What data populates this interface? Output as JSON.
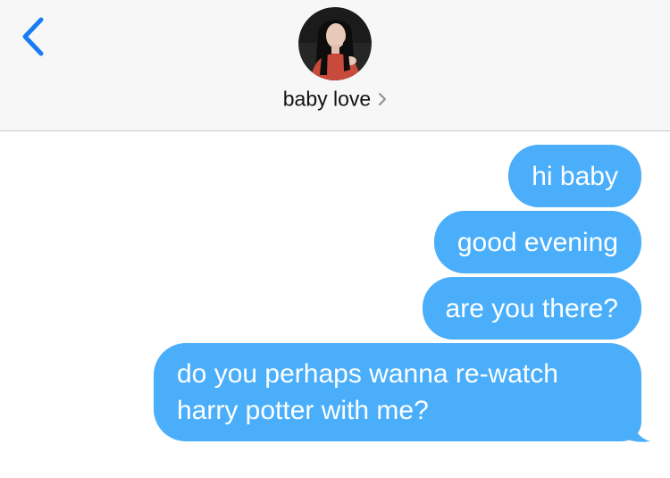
{
  "header": {
    "back_icon": "chevron-left-icon",
    "avatar_icon": "contact-photo",
    "contact_name": "baby love",
    "contact_chevron": "chevron-right-icon",
    "accent_color": "#1a7cf5",
    "background_color": "#f7f7f7"
  },
  "messages": [
    {
      "text": "hi baby",
      "sender": "me"
    },
    {
      "text": "good evening",
      "sender": "me"
    },
    {
      "text": "are you there?",
      "sender": "me"
    },
    {
      "text": "do you perhaps wanna re-watch harry potter with me?",
      "sender": "me"
    }
  ],
  "bubble_color": "#4aaefb"
}
